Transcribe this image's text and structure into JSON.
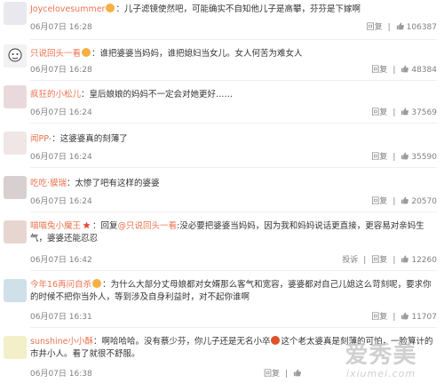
{
  "actions": {
    "reply_label": "回复",
    "report_label": "投诉",
    "like_icon": "thumbs-up-icon"
  },
  "comments": [
    {
      "user": "Joycelovesummer",
      "badge": "emoji-icon",
      "text": "：儿子滤镜使然吧，可能确实不自知他儿子是高攀，芬芬是下嫁啊",
      "time": "06月07日 16:28",
      "likes": "106387"
    },
    {
      "user": "只说回头一看",
      "badge": "emoji-icon",
      "text": "：谁把婆婆当妈妈，谁把媳妇当女儿。女人何苦为难女人",
      "time": "06月07日 16:28",
      "likes": "48384"
    },
    {
      "user": "疯狂的小松儿",
      "text": "：皇后娘娘的妈妈不一定会对她更好……",
      "time": "06月07日 16:24",
      "likes": "37569"
    },
    {
      "user": "闻PP-",
      "text": "：这婆婆真的刻薄了",
      "time": "06月07日 16:24",
      "likes": "35590"
    },
    {
      "user": "吃吃·貘瑞",
      "text": "：太惨了吧有这样的婆婆",
      "time": "06月07日 16:24",
      "likes": "20570"
    },
    {
      "user": "喵喵兔小魔王",
      "badge": "star-icon",
      "text": "：回复",
      "reply_to": "@只说回头一看",
      "text2": ":没必要把婆婆当妈妈，因为我和妈妈说话更直接，更容易对亲妈生气，婆婆还能忍忍",
      "time": "06月07日 16:42",
      "likes": "12260",
      "has_report": true
    },
    {
      "user": "今年16再问自杀",
      "badge": "emoji-icon",
      "text": "：为什么大部分丈母娘都对女婿那么客气和宽容，婆婆都对自己儿媳这么苛刻呢，要求你的时候不把你当外人，等到涉及自身利益时，对不起你谁啊",
      "time": "06月07日 16:31",
      "likes": "11707"
    },
    {
      "user": "sunshine小小酥",
      "text": "：啊哈哈哈。没有蔡少芬，你儿子还是无名小卒",
      "text2": "这个老太婆真是刻薄的可怕，一脸算计的市井小人。看了就很不舒服。",
      "time": "06月07日 16:38",
      "likes": ""
    }
  ],
  "watermark": {
    "main": "爱秀美",
    "sub": "ixiumei.com"
  }
}
